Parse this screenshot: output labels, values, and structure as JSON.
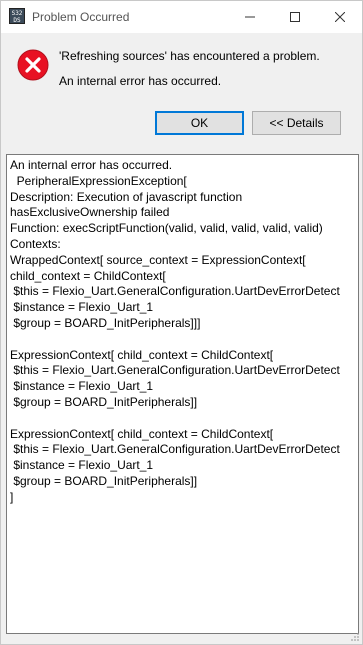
{
  "window": {
    "title": "Problem Occurred",
    "app_icon_text": "S32\nDS"
  },
  "message": {
    "title": "'Refreshing sources' has encountered a problem.",
    "detail": "An internal error has occurred."
  },
  "buttons": {
    "ok_label": "OK",
    "details_label": "<< Details"
  },
  "details": {
    "lines": [
      "An internal error has occurred.",
      "  PeripheralExpressionException[",
      "Description: Execution of javascript function",
      "hasExclusiveOwnership failed",
      "Function: execScriptFunction(valid, valid, valid, valid, valid)",
      "Contexts:",
      "WrappedContext[ source_context = ExpressionContext[",
      "child_context = ChildContext[",
      " $this = Flexio_Uart.GeneralConfiguration.UartDevErrorDetect",
      " $instance = Flexio_Uart_1",
      " $group = BOARD_InitPeripherals]]]",
      "",
      "ExpressionContext[ child_context = ChildContext[",
      " $this = Flexio_Uart.GeneralConfiguration.UartDevErrorDetect",
      " $instance = Flexio_Uart_1",
      " $group = BOARD_InitPeripherals]]",
      "",
      "ExpressionContext[ child_context = ChildContext[",
      " $this = Flexio_Uart.GeneralConfiguration.UartDevErrorDetect",
      " $instance = Flexio_Uart_1",
      " $group = BOARD_InitPeripherals]]",
      "]"
    ]
  },
  "icons": {
    "app": "s32ds-app-icon",
    "minimize": "minimize-icon",
    "maximize": "maximize-icon",
    "close": "close-icon",
    "error": "error-icon",
    "resize": "resize-grip-icon"
  },
  "colors": {
    "error_red": "#e81123",
    "ok_border": "#0078d7"
  }
}
